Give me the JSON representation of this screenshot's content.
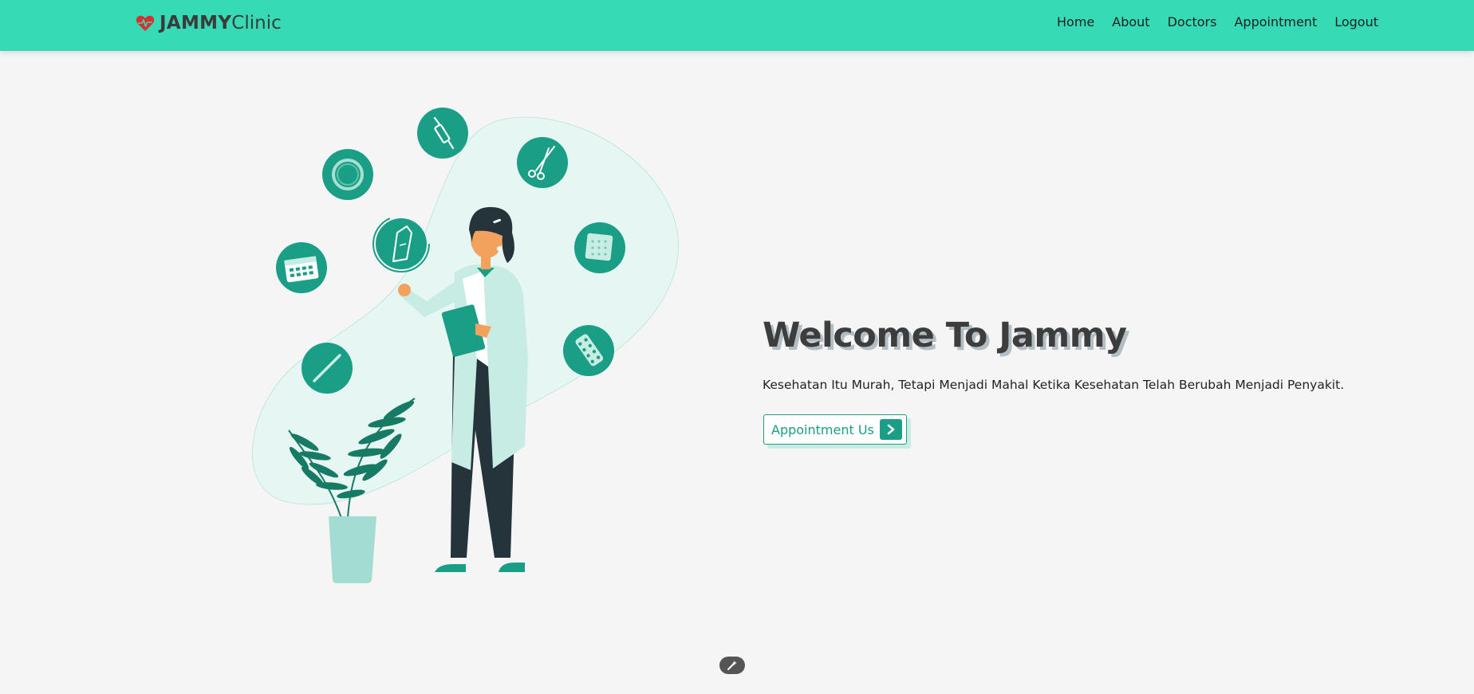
{
  "navbar": {
    "brand_bold": "JAMMY",
    "brand_light": "Clinic",
    "logo_icon": "heartbeat-icon",
    "links": [
      "Home",
      "About",
      "Doctors",
      "Appointment",
      "Logout"
    ]
  },
  "hero": {
    "title": "Welcome To Jammy",
    "subtitle": "Kesehatan Itu Murah, Tetapi Menjadi Mahal Ketika Kesehatan Telah Berubah Menjadi Penyakit.",
    "cta_label": "Appointment Us",
    "cta_icon": "chevron-right-icon"
  },
  "illustration": {
    "description_icon": "doctor-illustration",
    "icons": [
      "syringe-icon",
      "scissors-icon",
      "ring-icon",
      "bandage-icon",
      "calendar-icon",
      "gauze-icon",
      "thermometer-icon",
      "pills-icon"
    ]
  },
  "floating_button_icon": "magic-wand-icon",
  "colors": {
    "accent": "#36dab5",
    "brand_dark": "#1a9e85",
    "background": "#f5f5f5",
    "heart": "#d63031"
  }
}
